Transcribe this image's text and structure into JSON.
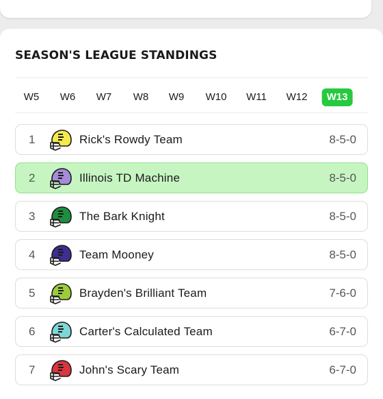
{
  "title": "SEASON'S LEAGUE STANDINGS",
  "weeks": [
    "W5",
    "W6",
    "W7",
    "W8",
    "W9",
    "W10",
    "W11",
    "W12",
    "W13"
  ],
  "active_week": "W13",
  "colors": {
    "accent": "#27c93f",
    "highlight_row": "#c6f5c2"
  },
  "standings": [
    {
      "rank": "1",
      "team": "Rick's Rowdy Team",
      "record": "8-5-0",
      "helmet_color": "#f4ea4b",
      "highlighted": false
    },
    {
      "rank": "2",
      "team": "Illinois TD Machine",
      "record": "8-5-0",
      "helmet_color": "#a68bd8",
      "highlighted": true
    },
    {
      "rank": "3",
      "team": "The Bark Knight",
      "record": "8-5-0",
      "helmet_color": "#1e8e3e",
      "highlighted": false
    },
    {
      "rank": "4",
      "team": "Team Mooney",
      "record": "8-5-0",
      "helmet_color": "#3b2f8f",
      "highlighted": false
    },
    {
      "rank": "5",
      "team": "Brayden's Brilliant Team",
      "record": "7-6-0",
      "helmet_color": "#9ccc3a",
      "highlighted": false
    },
    {
      "rank": "6",
      "team": "Carter's Calculated Team",
      "record": "6-7-0",
      "helmet_color": "#7ed6d6",
      "highlighted": false
    },
    {
      "rank": "7",
      "team": "John's Scary Team",
      "record": "6-7-0",
      "helmet_color": "#d9363e",
      "highlighted": false
    }
  ]
}
